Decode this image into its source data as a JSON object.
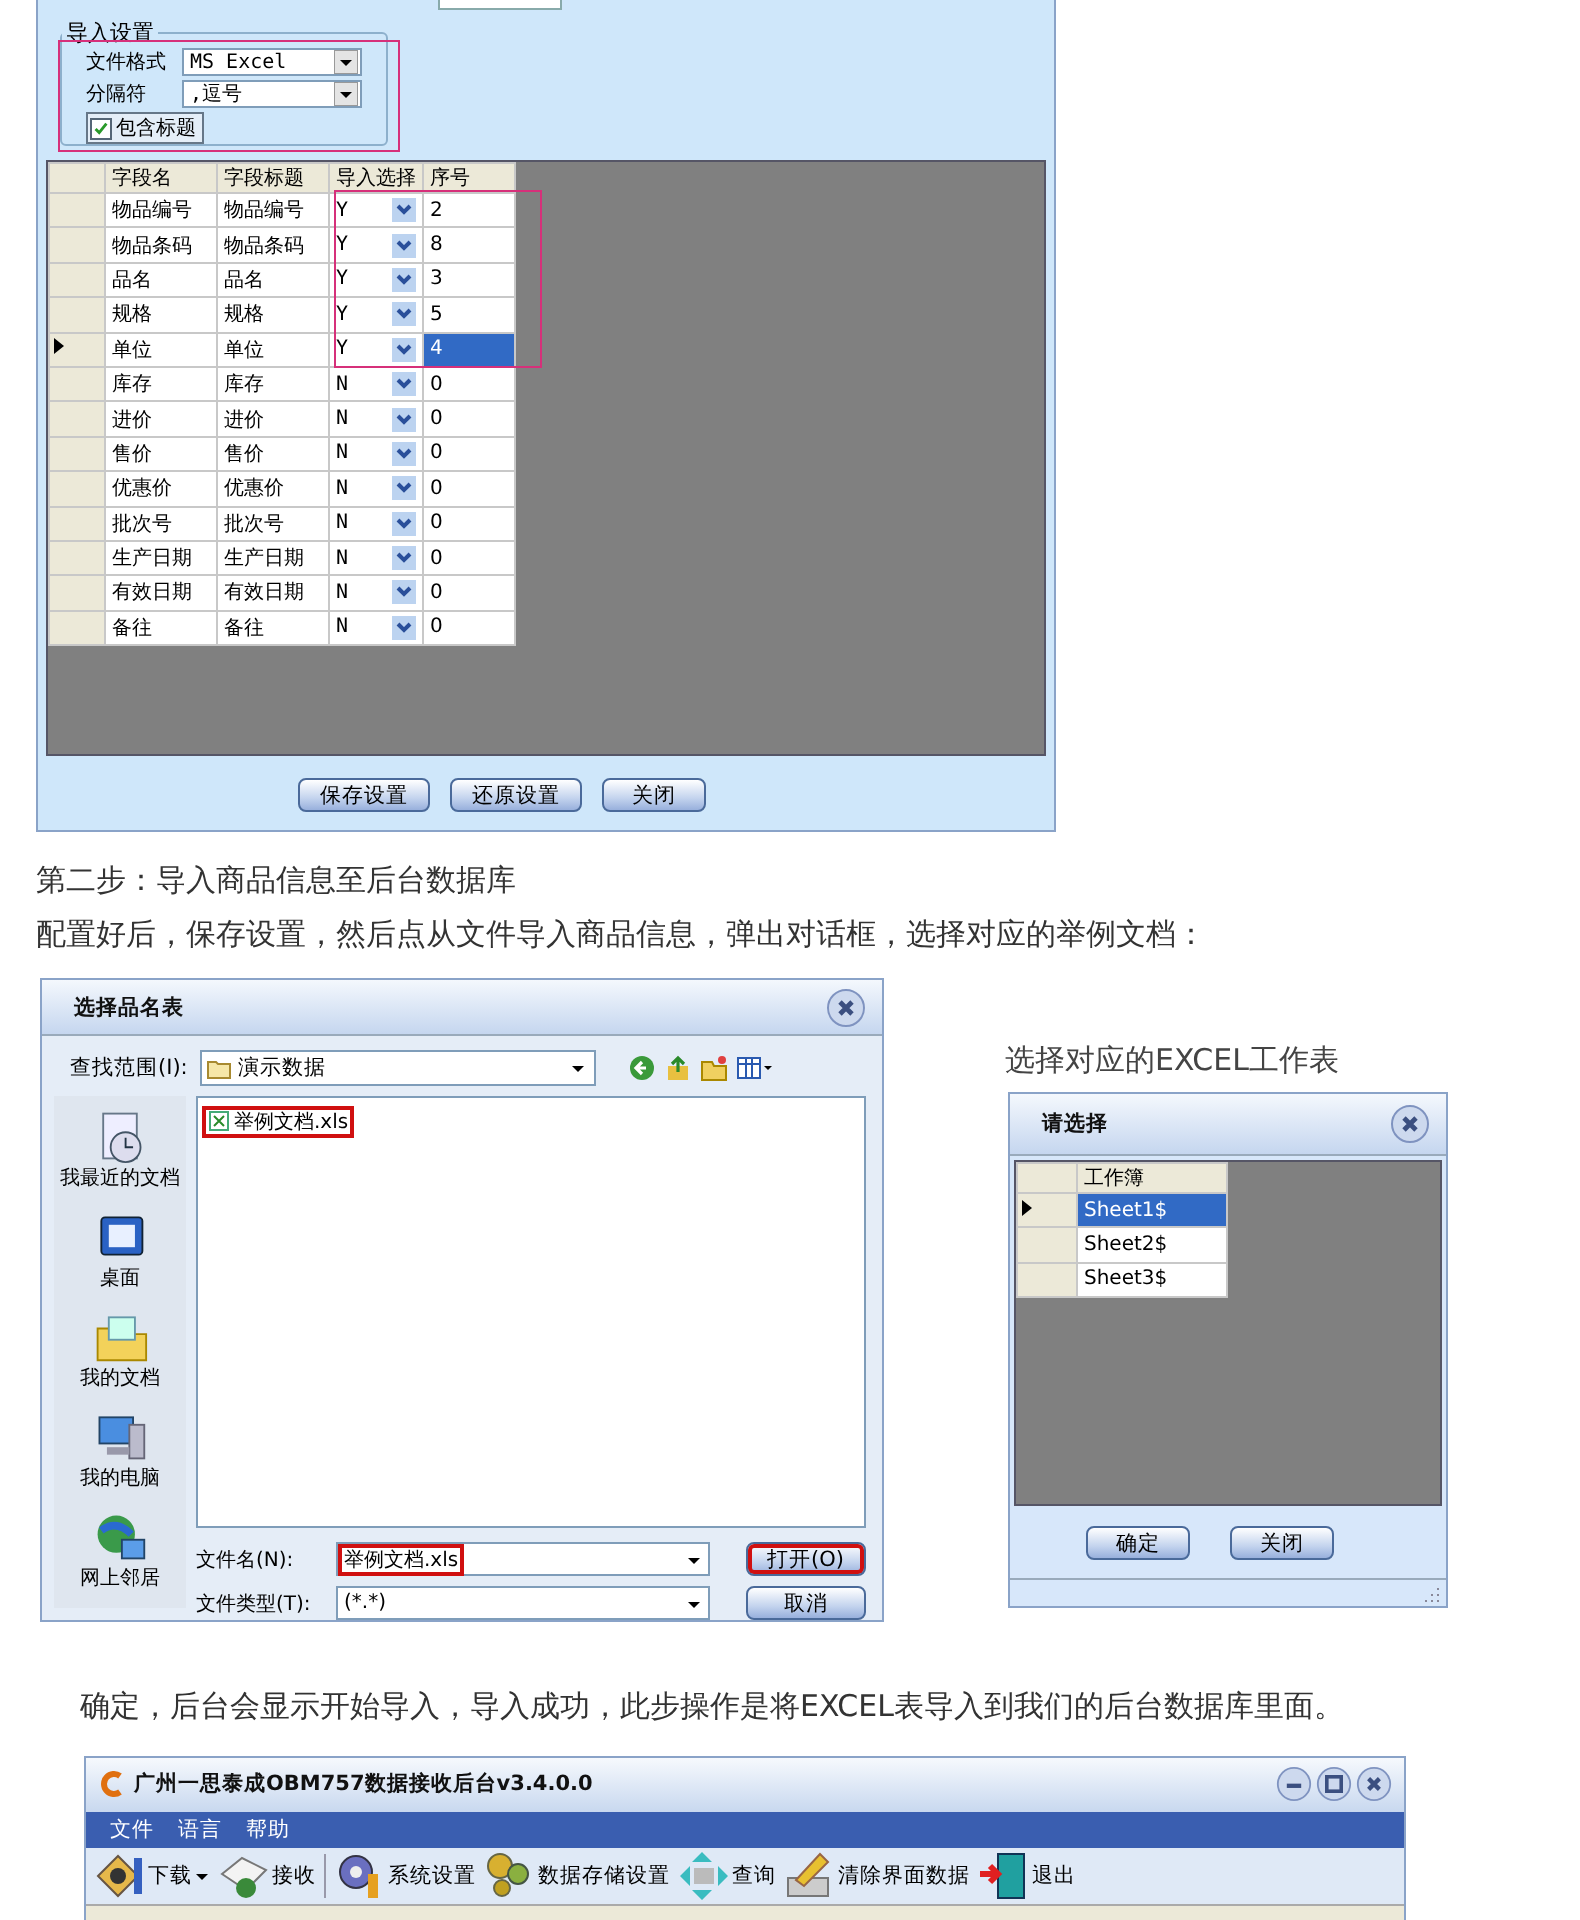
{
  "import_dialog": {
    "group_title": "导入设置",
    "file_format": {
      "label": "文件格式",
      "value": "MS Excel"
    },
    "separator": {
      "label": "分隔符",
      "value": ",逗号"
    },
    "include_header": {
      "label": "包含标题",
      "checked": true
    },
    "columns": [
      "字段名",
      "字段标题",
      "导入选择",
      "序号"
    ],
    "rows": [
      {
        "field": "物品编号",
        "title": "物品编号",
        "import": "Y",
        "order": "2",
        "selected": false
      },
      {
        "field": "物品条码",
        "title": "物品条码",
        "import": "Y",
        "order": "8",
        "selected": false
      },
      {
        "field": "品名",
        "title": "品名",
        "import": "Y",
        "order": "3",
        "selected": false
      },
      {
        "field": "规格",
        "title": "规格",
        "import": "Y",
        "order": "5",
        "selected": false
      },
      {
        "field": "单位",
        "title": "单位",
        "import": "Y",
        "order": "4",
        "selected": true
      },
      {
        "field": "库存",
        "title": "库存",
        "import": "N",
        "order": "0",
        "selected": false
      },
      {
        "field": "进价",
        "title": "进价",
        "import": "N",
        "order": "0",
        "selected": false
      },
      {
        "field": "售价",
        "title": "售价",
        "import": "N",
        "order": "0",
        "selected": false
      },
      {
        "field": "优惠价",
        "title": "优惠价",
        "import": "N",
        "order": "0",
        "selected": false
      },
      {
        "field": "批次号",
        "title": "批次号",
        "import": "N",
        "order": "0",
        "selected": false
      },
      {
        "field": "生产日期",
        "title": "生产日期",
        "import": "N",
        "order": "0",
        "selected": false
      },
      {
        "field": "有效日期",
        "title": "有效日期",
        "import": "N",
        "order": "0",
        "selected": false
      },
      {
        "field": "备往",
        "title": "备往",
        "import": "N",
        "order": "0",
        "selected": false
      }
    ],
    "buttons": [
      "保存设置",
      "还原设置",
      "关闭"
    ]
  },
  "step_title": "第二步：导入商品信息至后台数据库",
  "step_text": "配置好后，保存设置，然后点从文件导入商品信息，弹出对话框，选择对应的举例文档：",
  "file_dialog": {
    "title": "选择品名表",
    "look_in": {
      "label": "查找范围(I):",
      "value": "演示数据"
    },
    "places": [
      "我最近的文档",
      "桌面",
      "我的文档",
      "我的电脑",
      "网上邻居"
    ],
    "files": [
      {
        "name": "举例文档.xls",
        "highlighted": true
      }
    ],
    "file_name": {
      "label": "文件名(N):",
      "value": "举例文档.xls",
      "highlighted": true
    },
    "file_type": {
      "label": "文件类型(T):",
      "value": "(*.*)"
    },
    "buttons": [
      {
        "label": "打开(O)",
        "highlighted": true
      },
      {
        "label": "取消",
        "highlighted": false
      }
    ]
  },
  "sheet_caption": "选择对应的EXCEL工作表",
  "sheet_dialog": {
    "title": "请选择",
    "column": "工作簿",
    "rows": [
      {
        "name": "Sheet1$",
        "selected": true
      },
      {
        "name": "Sheet2$",
        "selected": false
      },
      {
        "name": "Sheet3$",
        "selected": false
      }
    ],
    "buttons": [
      "确定",
      "关闭"
    ]
  },
  "result_text": "确定，后台会显示开始导入，导入成功，此步操作是将EXCEL表导入到我们的后台数据库里面。",
  "app_window": {
    "title": "广州一思泰成OBM757数据接收后台v3.4.0.0",
    "menu": [
      "文件",
      "语言",
      "帮助"
    ],
    "toolbar": [
      {
        "kind": "dropdown",
        "label": "下载"
      },
      {
        "kind": "button",
        "label": "接收"
      },
      {
        "kind": "separator"
      },
      {
        "kind": "button",
        "label": "系统设置"
      },
      {
        "kind": "button",
        "label": "数据存储设置"
      },
      {
        "kind": "button",
        "label": "查询"
      },
      {
        "kind": "button",
        "label": "清除界面数据"
      },
      {
        "kind": "button",
        "label": "退出"
      }
    ]
  }
}
